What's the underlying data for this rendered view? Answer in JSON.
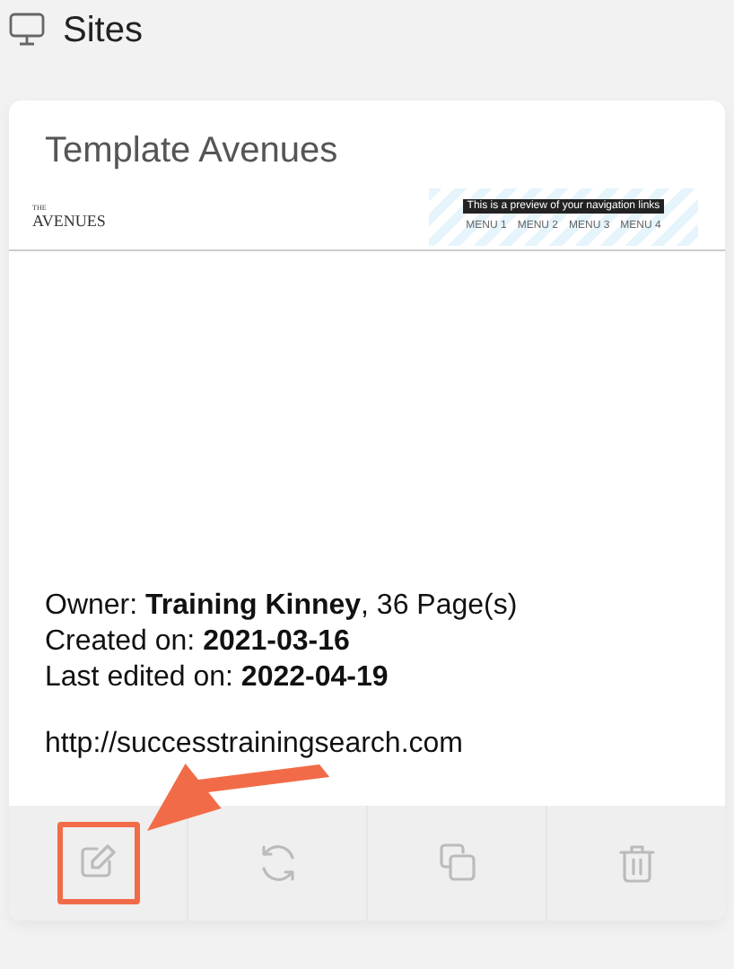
{
  "header": {
    "title": "Sites"
  },
  "card": {
    "title": "Template Avenues",
    "preview": {
      "logo_small": "THE",
      "logo": "AVENUES",
      "tooltip": "This is a preview of your navigation links",
      "menus": [
        "MENU 1",
        "MENU 2",
        "MENU 3",
        "MENU 4"
      ]
    },
    "details": [
      "Owner: **Training Kinney**, 36 Page(s)",
      "Created on: **2021-03-16**",
      "Last edited on: **2022-04-19**"
    ],
    "url": "http://successtrainingsearch.com",
    "actions": [
      {
        "kind": "edit",
        "highlighted": true
      },
      {
        "kind": "refresh",
        "highlighted": false
      },
      {
        "kind": "copy",
        "highlighted": false
      },
      {
        "kind": "delete",
        "highlighted": false
      }
    ]
  }
}
